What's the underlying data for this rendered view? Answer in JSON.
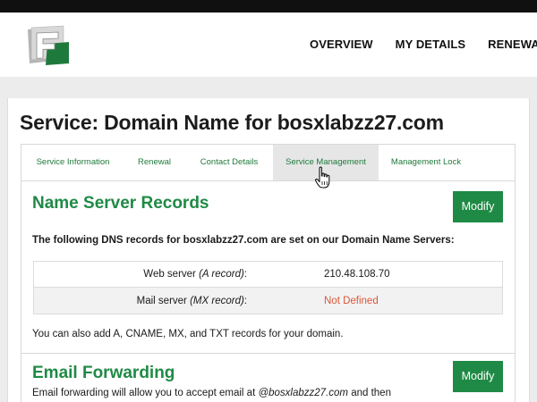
{
  "nav": {
    "items": [
      "OVERVIEW",
      "MY DETAILS",
      "RENEWALS"
    ]
  },
  "logo": {
    "icon": "f-logo-icon",
    "colors": {
      "green": "#1e7a3c",
      "gray": "#9a9a9a"
    }
  },
  "page": {
    "title": "Service: Domain Name for bosxlabzz27.com"
  },
  "tabs": [
    {
      "label": "Service Information",
      "active": false
    },
    {
      "label": "Renewal",
      "active": false
    },
    {
      "label": "Contact Details",
      "active": false
    },
    {
      "label": "Service Management",
      "active": true
    },
    {
      "label": "Management Lock",
      "active": false
    }
  ],
  "name_servers": {
    "title": "Name Server Records",
    "modify_label": "Modify",
    "lead": "The following DNS records for bosxlabzz27.com are set on our Domain Name Servers:",
    "records": [
      {
        "label": "Web server",
        "type": "(A record)",
        "suffix": ":",
        "value": "210.48.108.70"
      },
      {
        "label": "Mail server",
        "type": "(MX record)",
        "suffix": ":",
        "value": "Not Defined"
      }
    ],
    "note": "You can also add A, CNAME, MX, and TXT records for your domain."
  },
  "email_forwarding": {
    "title": "Email Forwarding",
    "modify_label": "Modify",
    "text_prefix": "Email forwarding will allow you to accept email at ",
    "text_em": "@bosxlabzz27.com",
    "text_suffix": " and then"
  },
  "colors": {
    "accent": "#1f8a45",
    "link": "#1f7a3a",
    "warning": "#d9583b"
  }
}
